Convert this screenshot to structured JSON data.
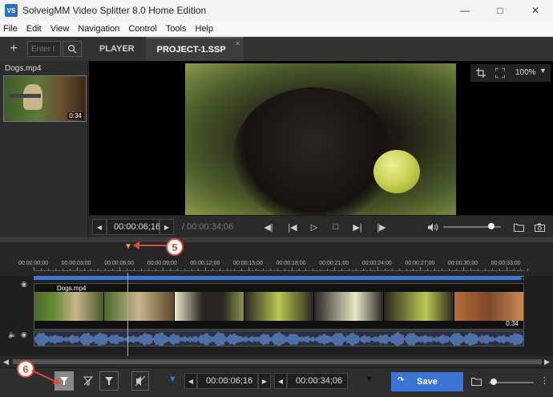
{
  "window": {
    "title": "SolveigMM Video Splitter 8.0 Home Edition",
    "icon_text": "VS"
  },
  "menu": [
    "File",
    "Edit",
    "View",
    "Navigation",
    "Control",
    "Tools",
    "Help"
  ],
  "toolbar": {
    "search_placeholder": "Enter t"
  },
  "tabs": [
    {
      "label": "PLAYER"
    },
    {
      "label": "PROJECT-1.SSP"
    }
  ],
  "media": {
    "file_name": "Dogs.mp4",
    "duration_badge": "0:34"
  },
  "player": {
    "zoom": "100%",
    "current_time": "00:00:06;16",
    "total_time": "/ 00:00:34;06",
    "volume": 0.84
  },
  "ruler": {
    "ticks": [
      "00:00:00;00",
      "00:00:03;00",
      "00:00:06;00",
      "00:00:09;00",
      "00:00:12;00",
      "00:00:15;00",
      "00:00:18;00",
      "00:00:21;00",
      "00:00:24;00",
      "00:00:27;00",
      "00:00:30;00",
      "00:00:33;00"
    ]
  },
  "track": {
    "clip_name": "Dogs.mp4",
    "clip_end_label": "0:34"
  },
  "annotations": {
    "marker_5": "5",
    "marker_6": "6"
  },
  "bottom": {
    "start_time": "00:00:06;16",
    "end_time": "00:00:34;06",
    "save_label": "Save",
    "zoom_level": 0.1
  },
  "colors": {
    "accent": "#3b76d6",
    "playhead": "#e8a33a",
    "annotation": "#e04a3b",
    "waveform": "#5b86c9"
  }
}
